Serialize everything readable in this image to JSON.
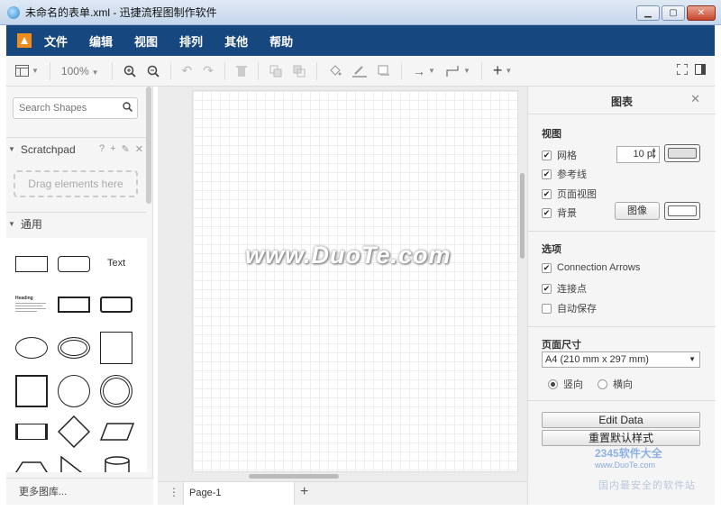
{
  "window": {
    "title": "未命名的表单.xml - 迅捷流程图制作软件",
    "controls": {
      "minimize": "▁",
      "maximize": "▢",
      "close": "✕"
    }
  },
  "menu": {
    "items": [
      "文件",
      "编辑",
      "视图",
      "排列",
      "其他",
      "帮助"
    ]
  },
  "toolbar": {
    "zoom": "100%"
  },
  "sidebar": {
    "search_placeholder": "Search Shapes",
    "scratchpad_label": "Scratchpad",
    "scratchpad_icons": [
      "?",
      "+",
      "✎",
      "✕"
    ],
    "drag_text": "Drag elements here",
    "general_label": "通用",
    "text_shape_label": "Text",
    "heading_shape_label": "Heading",
    "more_libraries": "更多图库..."
  },
  "canvas": {
    "watermark": "www.DuoTe.com",
    "page_tab": "Page-1",
    "page_menu_icon": "⋮",
    "add_page_icon": "+"
  },
  "format_panel": {
    "title": "图表",
    "close_icon": "✕",
    "view_section": "视图",
    "grid_label": "网格",
    "grid_size": "10 pt",
    "guides_label": "参考线",
    "page_view_label": "页面视图",
    "background_label": "背景",
    "image_button": "图像",
    "options_section": "选项",
    "connection_arrows_label": "Connection Arrows",
    "connection_points_label": "连接点",
    "autosave_label": "自动保存",
    "paper_size_section": "页面尺寸",
    "paper_size_value": "A4 (210 mm x 297 mm)",
    "portrait_label": "竖向",
    "landscape_label": "横向",
    "edit_data_button": "Edit Data",
    "reset_style_button": "重置默认样式"
  },
  "checkbox_states": {
    "grid": true,
    "guides": true,
    "page_view": true,
    "background": true,
    "connection_arrows": true,
    "connection_points": true,
    "autosave": false
  },
  "brand_watermark": {
    "name": "2345软件大全",
    "url": "www.DuoTe.com",
    "slogan": "国内最安全的软件站"
  },
  "colors": {
    "menubar": "#17477f",
    "grid_swatch": "#e0e0e0",
    "background_swatch": "#ffffff"
  }
}
